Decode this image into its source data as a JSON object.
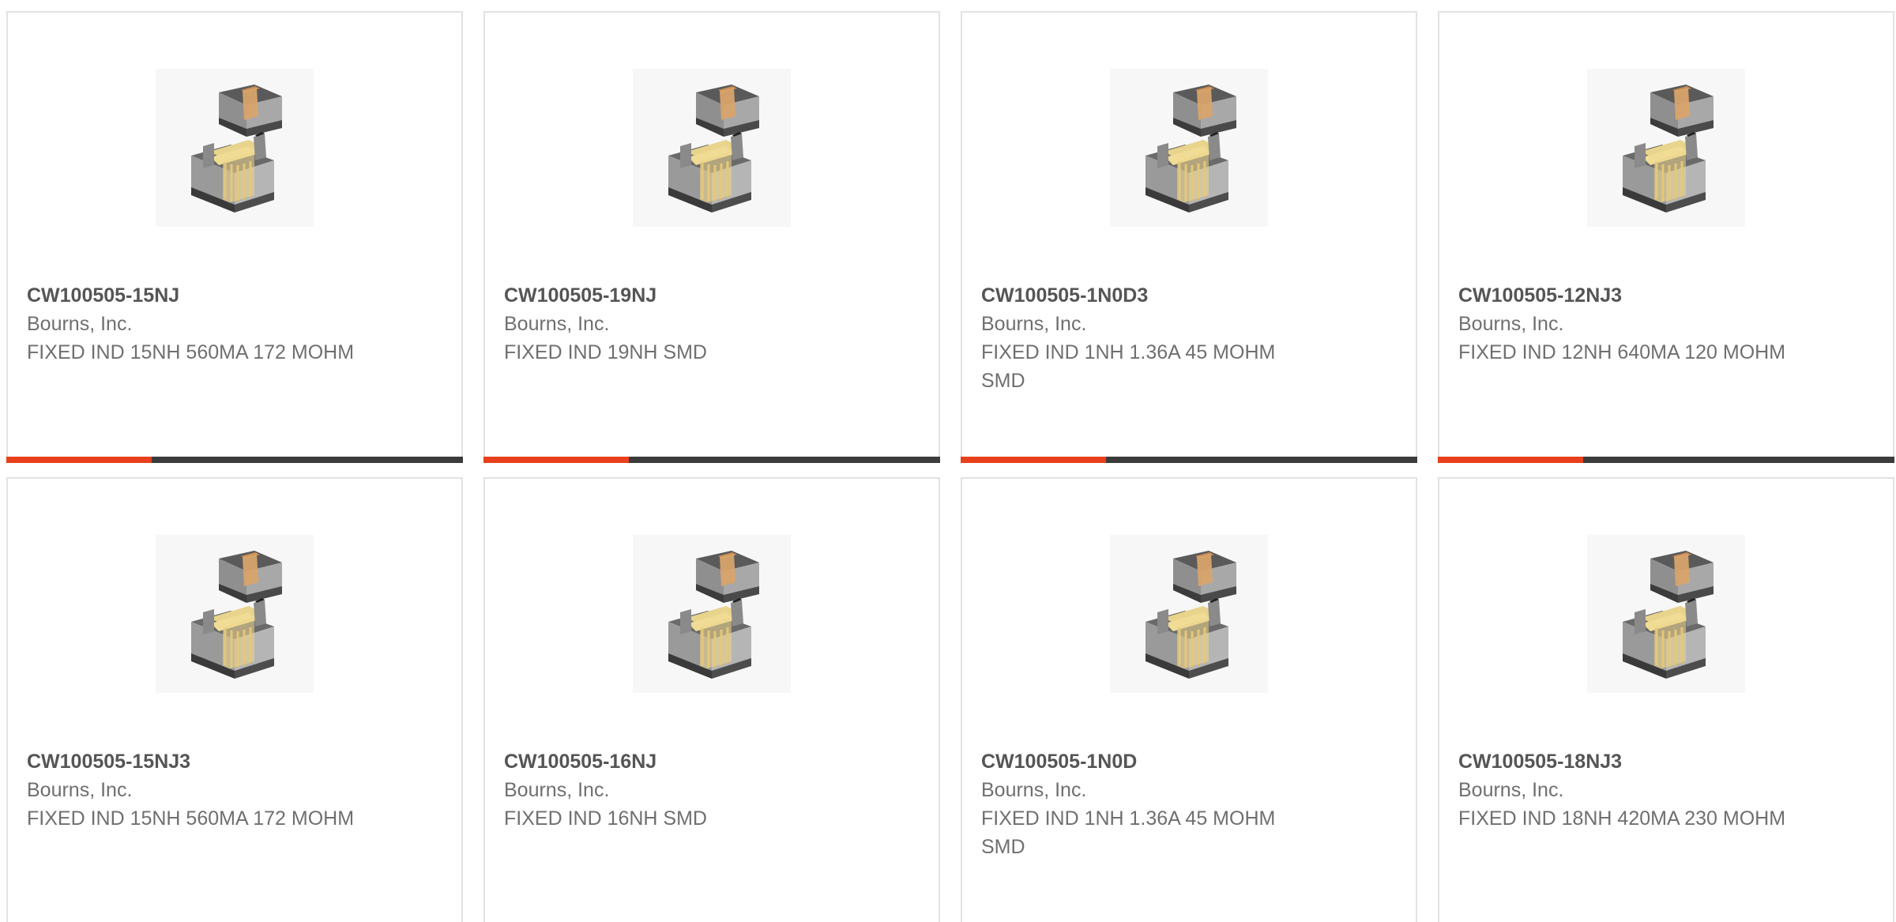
{
  "colors": {
    "accent": "#e8401c",
    "bar": "#3b3b3b",
    "border": "#e2e2e2",
    "part_number": "#555555",
    "secondary_text": "#6f6f6f"
  },
  "product_icon": "smd-inductor-icon",
  "products": [
    {
      "part_number": "CW100505-15NJ",
      "manufacturer": "Bourns, Inc.",
      "description": "FIXED IND 15NH 560MA 172 MOHM"
    },
    {
      "part_number": "CW100505-19NJ",
      "manufacturer": "Bourns, Inc.",
      "description": "FIXED IND 19NH SMD"
    },
    {
      "part_number": "CW100505-1N0D3",
      "manufacturer": "Bourns, Inc.",
      "description": "FIXED IND 1NH 1.36A 45 MOHM SMD"
    },
    {
      "part_number": "CW100505-12NJ3",
      "manufacturer": "Bourns, Inc.",
      "description": "FIXED IND 12NH 640MA 120 MOHM"
    },
    {
      "part_number": "CW100505-15NJ3",
      "manufacturer": "Bourns, Inc.",
      "description": "FIXED IND 15NH 560MA 172 MOHM"
    },
    {
      "part_number": "CW100505-16NJ",
      "manufacturer": "Bourns, Inc.",
      "description": "FIXED IND 16NH SMD"
    },
    {
      "part_number": "CW100505-1N0D",
      "manufacturer": "Bourns, Inc.",
      "description": "FIXED IND 1NH 1.36A 45 MOHM SMD"
    },
    {
      "part_number": "CW100505-18NJ3",
      "manufacturer": "Bourns, Inc.",
      "description": "FIXED IND 18NH 420MA 230 MOHM"
    }
  ]
}
